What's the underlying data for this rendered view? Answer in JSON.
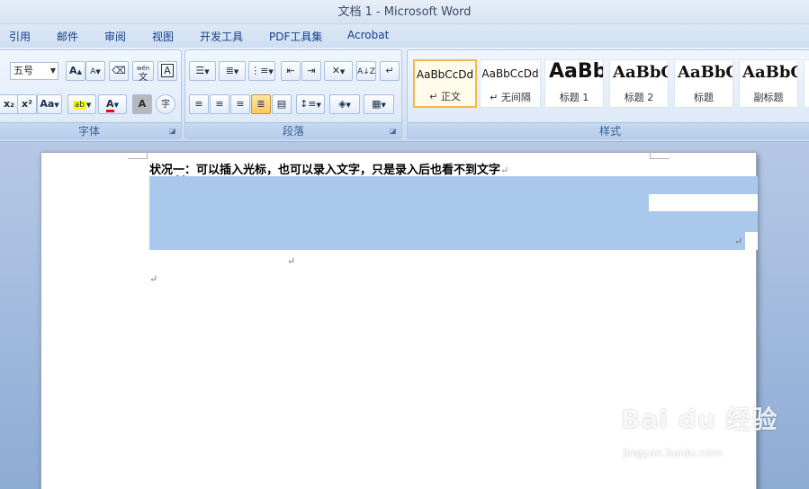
{
  "window": {
    "title": "文档 1 - Microsoft Word"
  },
  "menu_tabs": [
    "引用",
    "邮件",
    "审阅",
    "视图",
    "开发工具",
    "PDF工具集",
    "Acrobat"
  ],
  "ribbon": {
    "font_group": {
      "label": "字体",
      "font_size": "五号",
      "grow_font": "A",
      "shrink_font": "A",
      "subscript": "x₂",
      "superscript": "x²",
      "change_case": "Aa",
      "highlight": "ab",
      "font_color": "A",
      "char_shading": "A",
      "enclose_char": "字",
      "phonetic_guide": "wén",
      "phonetic_char": "文",
      "char_border": "A"
    },
    "paragraph_group": {
      "label": "段落"
    },
    "styles_group": {
      "label": "样式",
      "styles": [
        {
          "sample": "AaBbCcDd",
          "name": "↵ 正文"
        },
        {
          "sample": "AaBbCcDd",
          "name": "↵ 无间隔"
        },
        {
          "sample": "AaBb",
          "name": "标题 1"
        },
        {
          "sample": "AaBbC",
          "name": "标题 2"
        },
        {
          "sample": "AaBbC",
          "name": "标题"
        },
        {
          "sample": "AaBbC",
          "name": "副标题"
        }
      ]
    }
  },
  "document": {
    "line1_prefix": "状况",
    "line1_squiggle": "一",
    "line1_rest": "：可以插入光标，也可以录入文字，只是录入后也看不到文字",
    "paragraph_mark": "↵"
  },
  "watermark": {
    "logo": "Bai du 经验",
    "url": "jingyan.baidu.com"
  }
}
